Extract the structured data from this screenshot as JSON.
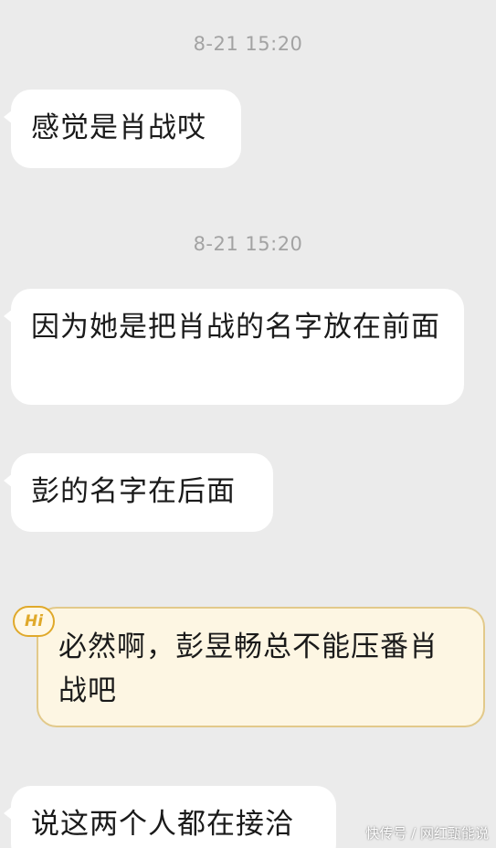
{
  "messages": [
    {
      "timestamp": "8-21 15:20",
      "text": "感觉是肖战哎"
    },
    {
      "timestamp": "8-21 15:20",
      "text": "因为她是把肖战的名字放在前面"
    },
    {
      "text": "彭的名字在后面"
    },
    {
      "text": "必然啊，彭昱畅总不能压番肖战吧",
      "badge": "Hi"
    },
    {
      "text": "说这两个人都在接洽"
    }
  ],
  "watermark": "快传号 / 网红甄能说",
  "colors": {
    "background": "#ebebeb",
    "bubble": "#ffffff",
    "highlight_bubble": "#fdf6e3",
    "highlight_border": "#e2c98a",
    "badge": "#e0a92a",
    "timestamp": "#a3a3a3"
  }
}
